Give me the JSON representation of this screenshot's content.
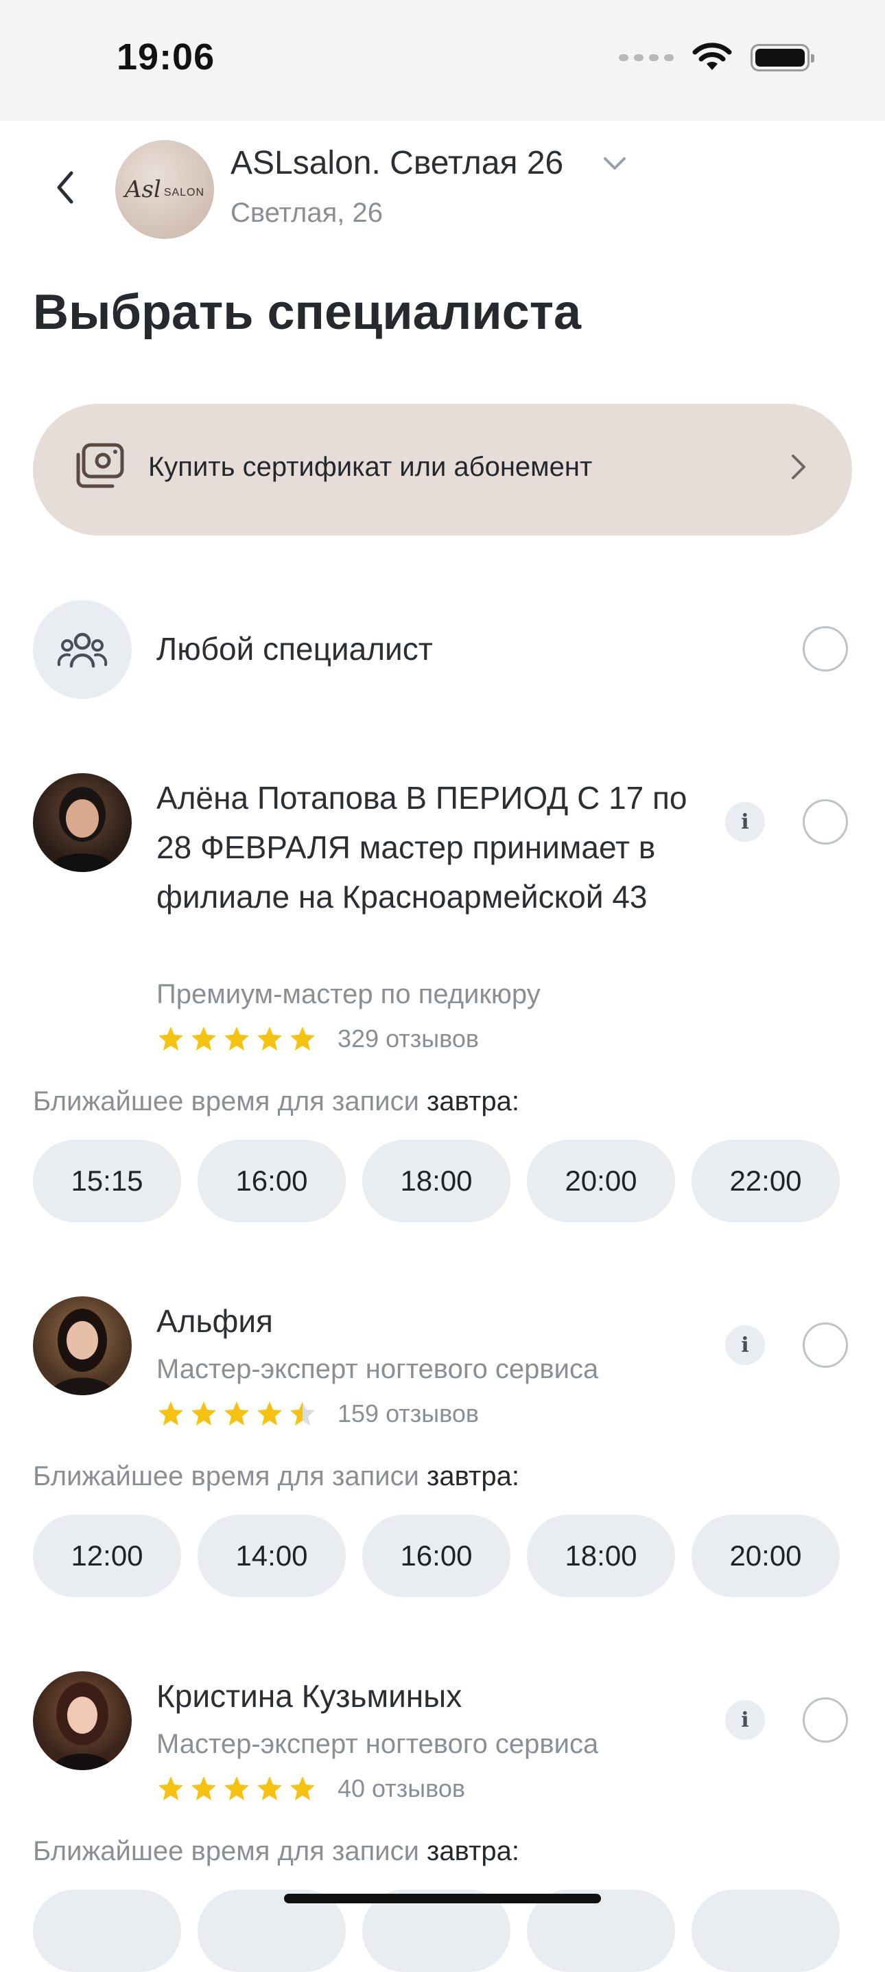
{
  "status_bar": {
    "time": "19:06"
  },
  "header": {
    "salon_name": "ASLsalon. Светлая 26",
    "salon_address": "Светлая, 26",
    "logo_script": "Asl",
    "logo_word": "SALON"
  },
  "title": "Выбрать специалиста",
  "certificate_banner": {
    "label": "Купить сертификат или абонемент"
  },
  "any_specialist": {
    "label": "Любой специалист"
  },
  "specialists": [
    {
      "name": "Алёна Потапова В ПЕРИОД С 17 по 28 ФЕВРАЛЯ мастер принимает в филиале на Красноармейской 43",
      "role": "Премиум-мастер по педикюру",
      "rating": 5,
      "reviews": "329 отзывов",
      "nearest_label": "Ближайшее время для записи ",
      "nearest_day": "завтра:",
      "slots": [
        "15:15",
        "16:00",
        "18:00",
        "20:00",
        "22:00"
      ]
    },
    {
      "name": "Альфия",
      "role": "Мастер-эксперт ногтевого сервиса",
      "rating": 4.5,
      "reviews": "159 отзывов",
      "nearest_label": "Ближайшее время для записи ",
      "nearest_day": "завтра:",
      "slots": [
        "12:00",
        "14:00",
        "16:00",
        "18:00",
        "20:00"
      ]
    },
    {
      "name": "Кристина Кузьминых",
      "role": "Мастер-эксперт ногтевого сервиса",
      "rating": 5,
      "reviews": "40 отзывов",
      "nearest_label": "Ближайшее время для записи ",
      "nearest_day": "завтра:",
      "slots": []
    }
  ],
  "colors": {
    "accent_banner": "#e6ddd8",
    "slot_bg": "#e9ecf1",
    "star": "#f5c211",
    "muted_text": "#8a8f96"
  },
  "icons": [
    "chevron-left-icon",
    "chevron-down-icon",
    "certificate-icon",
    "chevron-right-icon",
    "group-icon",
    "info-icon",
    "star-icon",
    "wifi-icon",
    "battery-icon"
  ]
}
